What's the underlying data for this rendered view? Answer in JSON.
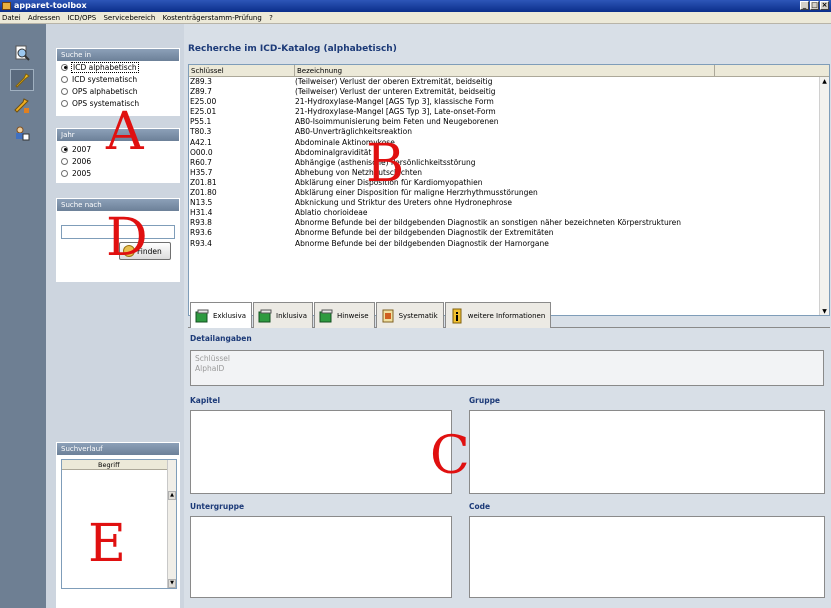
{
  "window": {
    "title": "apparet-toolbox",
    "controls": [
      "_",
      "□",
      "×"
    ]
  },
  "menu": [
    "Datei",
    "Adressen",
    "ICD/OPS",
    "Servicebereich",
    "Kostenträgerstamm-Prüfung",
    "?"
  ],
  "sidebar_icons": [
    "search-tool-icon",
    "wrench-tool-icon",
    "wrench-settings-icon",
    "user-admin-icon"
  ],
  "search_in": {
    "title": "Suche in",
    "options": [
      {
        "label": "ICD alphabetisch",
        "selected": true
      },
      {
        "label": "ICD systematisch",
        "selected": false
      },
      {
        "label": "OPS alphabetisch",
        "selected": false
      },
      {
        "label": "OPS systematisch",
        "selected": false
      }
    ]
  },
  "year": {
    "title": "Jahr",
    "options": [
      {
        "label": "2007",
        "selected": true
      },
      {
        "label": "2006",
        "selected": false
      },
      {
        "label": "2005",
        "selected": false
      }
    ]
  },
  "search_by": {
    "title": "Suche nach",
    "value": "",
    "button_label": "Finden"
  },
  "history": {
    "title": "Suchverlauf",
    "column": "Begriff",
    "scroll_up": "▲",
    "scroll_down": "▼"
  },
  "results": {
    "title": "Recherche im ICD-Katalog (alphabetisch)",
    "columns": [
      "Schlüssel",
      "Bezeichnung"
    ],
    "scroll_up": "▲",
    "scroll_down": "▼",
    "rows": [
      {
        "key": "Z89.3",
        "desc": "(Teilweiser) Verlust der oberen Extremität, beidseitig"
      },
      {
        "key": "Z89.7",
        "desc": "(Teilweiser) Verlust der unteren Extremität, beidseitig"
      },
      {
        "key": "E25.00",
        "desc": "21-Hydroxylase-Mangel [AGS Typ 3], klassische Form"
      },
      {
        "key": "E25.01",
        "desc": "21-Hydroxylase-Mangel [AGS Typ 3], Late-onset-Form"
      },
      {
        "key": "P55.1",
        "desc": "AB0-Isoimmunisierung beim Feten und Neugeborenen"
      },
      {
        "key": "T80.3",
        "desc": "AB0-Unverträglichkeitsreaktion"
      },
      {
        "key": "A42.1",
        "desc": "Abdominale Aktinomykose"
      },
      {
        "key": "O00.0",
        "desc": "Abdominalgravidität"
      },
      {
        "key": "R60.7",
        "desc": "Abhängige (asthenische) Persönlichkeitsstörung"
      },
      {
        "key": "H35.7",
        "desc": "Abhebung von Netzhautschichten"
      },
      {
        "key": "Z01.81",
        "desc": "Abklärung einer Disposition für Kardiomyopathien"
      },
      {
        "key": "Z01.80",
        "desc": "Abklärung einer Disposition für maligne Herzrhythmusstörungen"
      },
      {
        "key": "N13.5",
        "desc": "Abknickung und Striktur des Ureters ohne Hydronephrose"
      },
      {
        "key": "H31.4",
        "desc": "Ablatio chorioideae"
      },
      {
        "key": "R93.8",
        "desc": "Abnorme Befunde bei der bildgebenden Diagnostik an sonstigen näher bezeichneten Körperstrukturen"
      },
      {
        "key": "R93.6",
        "desc": "Abnorme Befunde bei der bildgebenden Diagnostik der Extremitäten"
      },
      {
        "key": "R93.4",
        "desc": "Abnorme Befunde bei der bildgebenden Diagnostik der Harnorgane"
      }
    ]
  },
  "tabs": [
    {
      "label": "Exklusiva",
      "active": true,
      "icon": "book-icon"
    },
    {
      "label": "Inklusiva",
      "active": false,
      "icon": "book-icon"
    },
    {
      "label": "Hinweise",
      "active": false,
      "icon": "book-icon"
    },
    {
      "label": "Systematik",
      "active": false,
      "icon": "document-icon"
    },
    {
      "label": "weitere Informationen",
      "active": false,
      "icon": "info-icon"
    }
  ],
  "details": {
    "title": "Detailangaben",
    "line1": "Schlüssel",
    "line2": "AlphaID",
    "kapitel": "Kapitel",
    "gruppe": "Gruppe",
    "untergruppe": "Untergruppe",
    "code": "Code"
  },
  "overlay_letters": [
    "A",
    "B",
    "C",
    "D",
    "E"
  ],
  "colors": {
    "overlay": "#e01010",
    "title_bar": "#0b2e8a",
    "heading": "#1c3a78"
  }
}
